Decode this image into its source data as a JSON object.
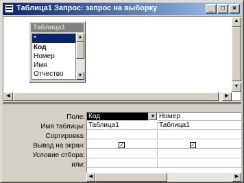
{
  "window": {
    "title": "Таблица1 Запрос: запрос на выборку",
    "buttons": {
      "minimize": "_",
      "maximize": "□",
      "close": "×"
    }
  },
  "field_list": {
    "title": "Таблица1",
    "items": [
      "*",
      "Код",
      "Номер",
      "Имя",
      "Отчество"
    ],
    "selected_index": 0
  },
  "grid": {
    "row_labels": [
      "Поле:",
      "Имя таблицы:",
      "Сортировка:",
      "Вывод на экран:",
      "Условие отбора:",
      "или:"
    ],
    "columns": [
      {
        "field": "Код",
        "table": "Таблица1",
        "sort": "",
        "show": "✓",
        "criteria": "",
        "or": ""
      },
      {
        "field": "Номер",
        "table": "Таблица1",
        "sort": "",
        "show": "✓",
        "criteria": "",
        "or": ""
      }
    ]
  },
  "icons": {
    "scroll_up": "▲",
    "scroll_down": "▼",
    "scroll_left": "◀",
    "scroll_right": "▶",
    "dropdown": "▼"
  }
}
